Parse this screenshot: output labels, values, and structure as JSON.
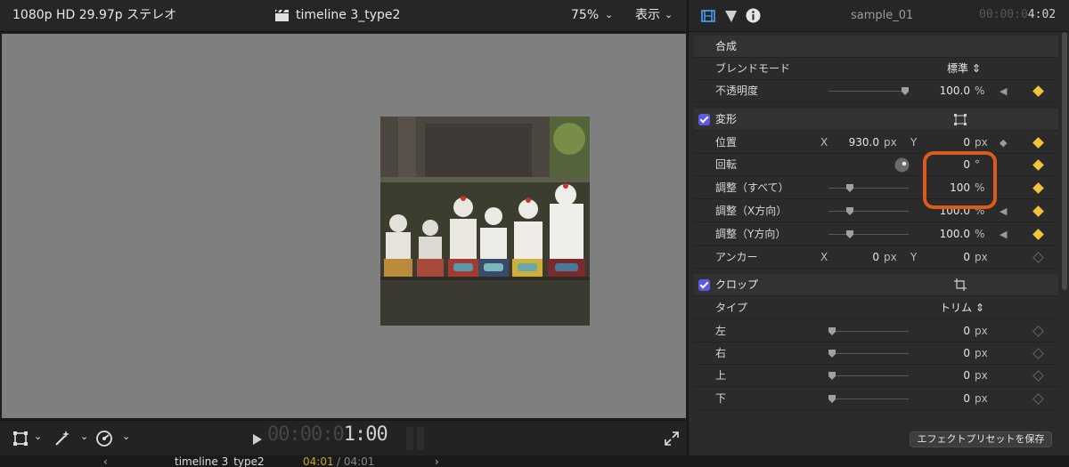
{
  "viewer": {
    "format_info": "1080p HD 29.97p ステレオ",
    "timeline_title": "timeline 3_type2",
    "zoom_level": "75%",
    "view_menu": "表示",
    "timecode_dim": "00:00:0",
    "timecode_bright": "1:00"
  },
  "inspector": {
    "clip_name": "sample_01",
    "clip_duration_dim": "00:00:0",
    "clip_duration_bright": "4:02",
    "compositing": {
      "section_label": "合成",
      "blend_mode_label": "ブレンドモード",
      "blend_mode_value": "標準",
      "opacity_label": "不透明度",
      "opacity_value": "100.0",
      "opacity_unit": "%",
      "opacity_fraction": 1.0
    },
    "transform": {
      "section_label": "変形",
      "position_label": "位置",
      "position_x_label": "X",
      "position_x_value": "930.0",
      "position_x_unit": "px",
      "position_y_label": "Y",
      "position_y_value": "0",
      "position_y_unit": "px",
      "rotation_label": "回転",
      "rotation_value": "0",
      "rotation_unit": "°",
      "scale_all_label": "調整（すべて）",
      "scale_all_value": "100",
      "scale_all_unit": "%",
      "scale_x_label": "調整（X方向）",
      "scale_x_value": "100.0",
      "scale_x_unit": "%",
      "scale_y_label": "調整（Y方向）",
      "scale_y_value": "100.0",
      "scale_y_unit": "%",
      "anchor_label": "アンカー",
      "anchor_x_label": "X",
      "anchor_x_value": "0",
      "anchor_x_unit": "px",
      "anchor_y_label": "Y",
      "anchor_y_value": "0",
      "anchor_y_unit": "px"
    },
    "crop": {
      "section_label": "クロップ",
      "type_label": "タイプ",
      "type_value": "トリム",
      "left_label": "左",
      "left_value": "0",
      "left_unit": "px",
      "right_label": "右",
      "right_value": "0",
      "right_unit": "px",
      "top_label": "上",
      "top_value": "0",
      "top_unit": "px",
      "bottom_label": "下",
      "bottom_value": "0",
      "bottom_unit": "px"
    },
    "save_preset_label": "エフェクトプリセットを保存"
  },
  "bottom_strip": {
    "timeline_name": "timeline 3_type2",
    "timecode_current": "04:01",
    "timecode_total": "/ 04:01"
  },
  "colors": {
    "accent": "#5b59e6",
    "keyframe": "#f3c23a",
    "highlight": "#dd5a1e",
    "canvas": "#7f7f7f"
  }
}
